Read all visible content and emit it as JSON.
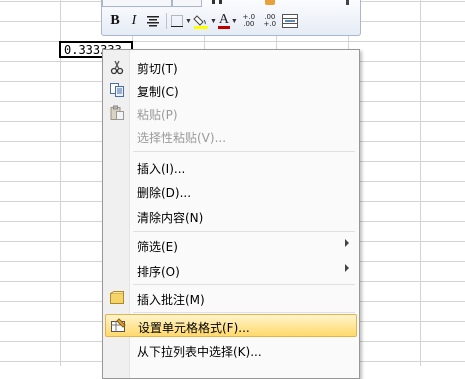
{
  "cell": {
    "value": "0.333333"
  },
  "mini_toolbar": {
    "bold": "B",
    "italic": "I",
    "font_color_letter": "A",
    "increase_decimal": "+.0\n.00",
    "decrease_decimal": ".00\n+.0",
    "font_color": "#c00000",
    "fill_color": "#ffff00"
  },
  "menu": {
    "items": [
      {
        "label": "剪切(T)",
        "icon": "scissors-icon",
        "enabled": true
      },
      {
        "label": "复制(C)",
        "icon": "copy-icon",
        "enabled": true
      },
      {
        "label": "粘贴(P)",
        "icon": "paste-icon",
        "enabled": false
      },
      {
        "label": "选择性粘贴(V)...",
        "enabled": false
      },
      {
        "label": "插入(I)...",
        "enabled": true
      },
      {
        "label": "删除(D)...",
        "enabled": true
      },
      {
        "label": "清除内容(N)",
        "enabled": true
      },
      {
        "label": "筛选(E)",
        "enabled": true,
        "submenu": true
      },
      {
        "label": "排序(O)",
        "enabled": true,
        "submenu": true
      },
      {
        "label": "插入批注(M)",
        "icon": "comment-icon",
        "enabled": true
      },
      {
        "label": "设置单元格格式(F)...",
        "icon": "format-cells-icon",
        "enabled": true,
        "highlighted": true
      },
      {
        "label": "从下拉列表中选择(K)...",
        "enabled": true
      }
    ]
  }
}
